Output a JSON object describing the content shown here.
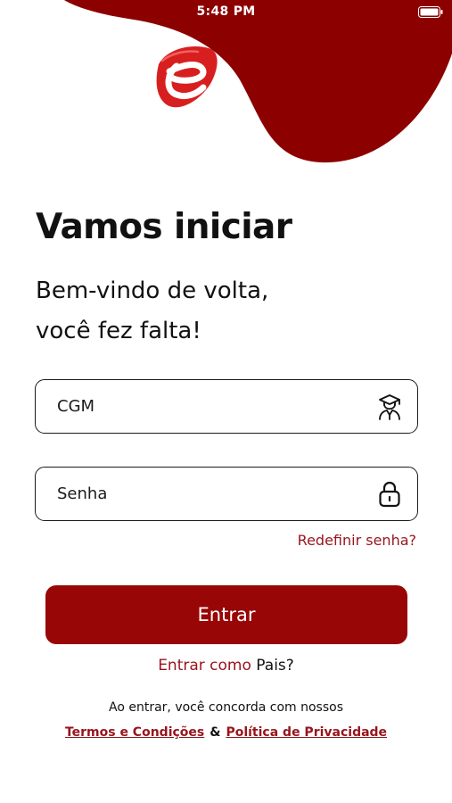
{
  "status_bar": {
    "time": "5:48 PM"
  },
  "colors": {
    "brand": "#980606",
    "link": "#97151c",
    "text": "#111111",
    "border": "#1a1a1a"
  },
  "header": {
    "logo_icon": "brand-e-logo-icon"
  },
  "title": "Vamos iniciar",
  "subtitle": {
    "line1": "Bem-vindo de volta,",
    "line2": "você fez falta!"
  },
  "form": {
    "cgm": {
      "placeholder": "CGM",
      "value": "",
      "icon": "student-graduate-icon"
    },
    "password": {
      "placeholder": "Senha",
      "value": "",
      "icon": "lock-icon"
    },
    "forgot_label": "Redefinir senha?",
    "submit_label": "Entrar"
  },
  "parents": {
    "prefix": "Entrar como",
    "highlight": "Pais?"
  },
  "legal": {
    "text": "Ao entrar, você concorda com nossos",
    "terms_label": "Termos e Condições",
    "separator": "&",
    "privacy_label": "Política de Privacidade"
  }
}
